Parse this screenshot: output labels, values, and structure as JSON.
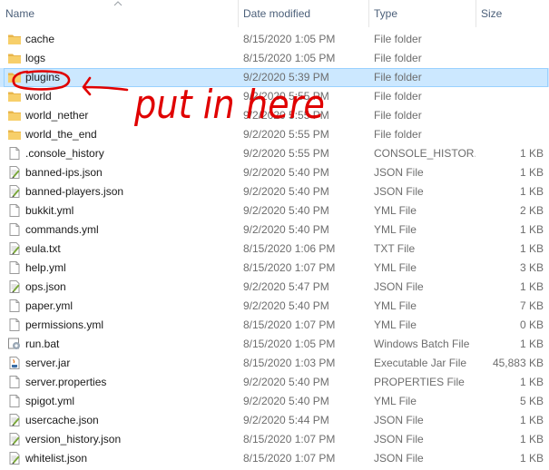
{
  "columns": {
    "name": "Name",
    "date": "Date modified",
    "type": "Type",
    "size": "Size"
  },
  "annotation": {
    "text": "put in here",
    "color": "#e00000"
  },
  "files": [
    {
      "name": "cache",
      "date": "8/15/2020 1:05 PM",
      "type": "File folder",
      "size": "",
      "icon": "folder-icon"
    },
    {
      "name": "logs",
      "date": "8/15/2020 1:05 PM",
      "type": "File folder",
      "size": "",
      "icon": "folder-icon"
    },
    {
      "name": "plugins",
      "date": "9/2/2020 5:39 PM",
      "type": "File folder",
      "size": "",
      "icon": "folder-icon",
      "selected": true
    },
    {
      "name": "world",
      "date": "9/2/2020 5:55 PM",
      "type": "File folder",
      "size": "",
      "icon": "folder-icon"
    },
    {
      "name": "world_nether",
      "date": "9/2/2020 5:55 PM",
      "type": "File folder",
      "size": "",
      "icon": "folder-icon"
    },
    {
      "name": "world_the_end",
      "date": "9/2/2020 5:55 PM",
      "type": "File folder",
      "size": "",
      "icon": "folder-icon"
    },
    {
      "name": ".console_history",
      "date": "9/2/2020 5:55 PM",
      "type": "CONSOLE_HISTOR...",
      "size": "1 KB",
      "icon": "blank-file-icon"
    },
    {
      "name": "banned-ips.json",
      "date": "9/2/2020 5:40 PM",
      "type": "JSON File",
      "size": "1 KB",
      "icon": "notepad-file-icon"
    },
    {
      "name": "banned-players.json",
      "date": "9/2/2020 5:40 PM",
      "type": "JSON File",
      "size": "1 KB",
      "icon": "notepad-file-icon"
    },
    {
      "name": "bukkit.yml",
      "date": "9/2/2020 5:40 PM",
      "type": "YML File",
      "size": "2 KB",
      "icon": "blank-file-icon"
    },
    {
      "name": "commands.yml",
      "date": "9/2/2020 5:40 PM",
      "type": "YML File",
      "size": "1 KB",
      "icon": "blank-file-icon"
    },
    {
      "name": "eula.txt",
      "date": "8/15/2020 1:06 PM",
      "type": "TXT File",
      "size": "1 KB",
      "icon": "notepad-file-icon"
    },
    {
      "name": "help.yml",
      "date": "8/15/2020 1:07 PM",
      "type": "YML File",
      "size": "3 KB",
      "icon": "blank-file-icon"
    },
    {
      "name": "ops.json",
      "date": "9/2/2020 5:47 PM",
      "type": "JSON File",
      "size": "1 KB",
      "icon": "notepad-file-icon"
    },
    {
      "name": "paper.yml",
      "date": "9/2/2020 5:40 PM",
      "type": "YML File",
      "size": "7 KB",
      "icon": "blank-file-icon"
    },
    {
      "name": "permissions.yml",
      "date": "8/15/2020 1:07 PM",
      "type": "YML File",
      "size": "0 KB",
      "icon": "blank-file-icon"
    },
    {
      "name": "run.bat",
      "date": "8/15/2020 1:05 PM",
      "type": "Windows Batch File",
      "size": "1 KB",
      "icon": "batch-file-icon"
    },
    {
      "name": "server.jar",
      "date": "8/15/2020 1:03 PM",
      "type": "Executable Jar File",
      "size": "45,883 KB",
      "icon": "java-jar-icon"
    },
    {
      "name": "server.properties",
      "date": "9/2/2020 5:40 PM",
      "type": "PROPERTIES File",
      "size": "1 KB",
      "icon": "blank-file-icon"
    },
    {
      "name": "spigot.yml",
      "date": "9/2/2020 5:40 PM",
      "type": "YML File",
      "size": "5 KB",
      "icon": "blank-file-icon"
    },
    {
      "name": "usercache.json",
      "date": "9/2/2020 5:44 PM",
      "type": "JSON File",
      "size": "1 KB",
      "icon": "notepad-file-icon"
    },
    {
      "name": "version_history.json",
      "date": "8/15/2020 1:07 PM",
      "type": "JSON File",
      "size": "1 KB",
      "icon": "notepad-file-icon"
    },
    {
      "name": "whitelist.json",
      "date": "8/15/2020 1:07 PM",
      "type": "JSON File",
      "size": "1 KB",
      "icon": "notepad-file-icon"
    }
  ]
}
